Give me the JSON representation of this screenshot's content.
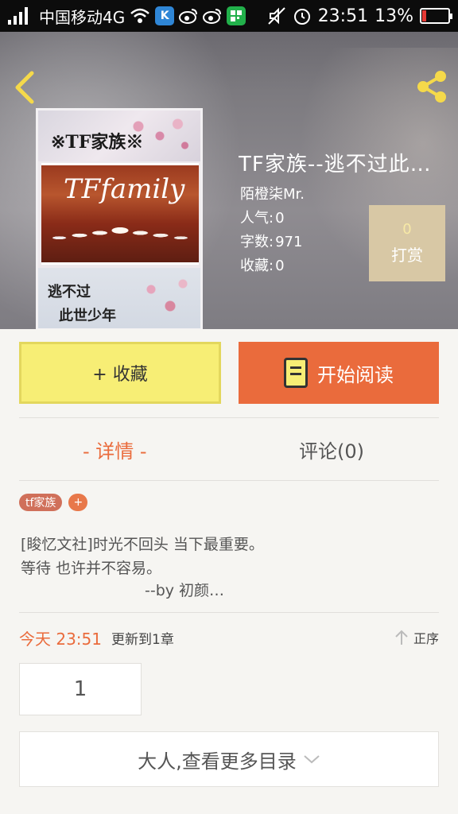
{
  "status_bar": {
    "carrier": "中国移动4G",
    "time": "23:51",
    "battery": "13%",
    "app_icon_k": "K",
    "colors": {
      "k_icon": "#2f86d6",
      "green_icon": "#22b04b",
      "battery_low": "#e53935"
    }
  },
  "header": {
    "back_icon": "chevron-left-icon",
    "share_icon": "share-icon",
    "accent": "#f5d94a"
  },
  "cover": {
    "title": "※TF家族※",
    "brand": "TFfamily",
    "subtitle_line1": "逃不过",
    "subtitle_line2": "此世少年"
  },
  "book": {
    "title": "TF家族--逃不过此…",
    "author": "陌橙柒Mr.",
    "popularity_label": "人气:",
    "popularity": "0",
    "words_label": "字数:",
    "words": "971",
    "favorites_label": "收藏:",
    "favorites": "0"
  },
  "tip": {
    "count": "0",
    "label": "打赏"
  },
  "actions": {
    "favorite_label": "+ 收藏",
    "read_label": "开始阅读",
    "colors": {
      "favorite_bg": "#f7ee75",
      "read_bg": "#ea6b3c"
    }
  },
  "tabs": [
    {
      "label": "- 详情 -",
      "active": true
    },
    {
      "label": "评论(0)",
      "active": false
    }
  ],
  "tags": {
    "items": [
      "tf家族"
    ],
    "add_label": "+"
  },
  "description": {
    "line1": "[睃忆文社]时光不回头 当下最重要。",
    "line2": "等待 也许并不容易。",
    "line3": "--by  初颜…"
  },
  "updates": {
    "time": "今天 23:51",
    "text": "更新到1章",
    "sort_label": "正序"
  },
  "chapters": {
    "first": "1"
  },
  "more": {
    "label": "大人,查看更多目录"
  }
}
